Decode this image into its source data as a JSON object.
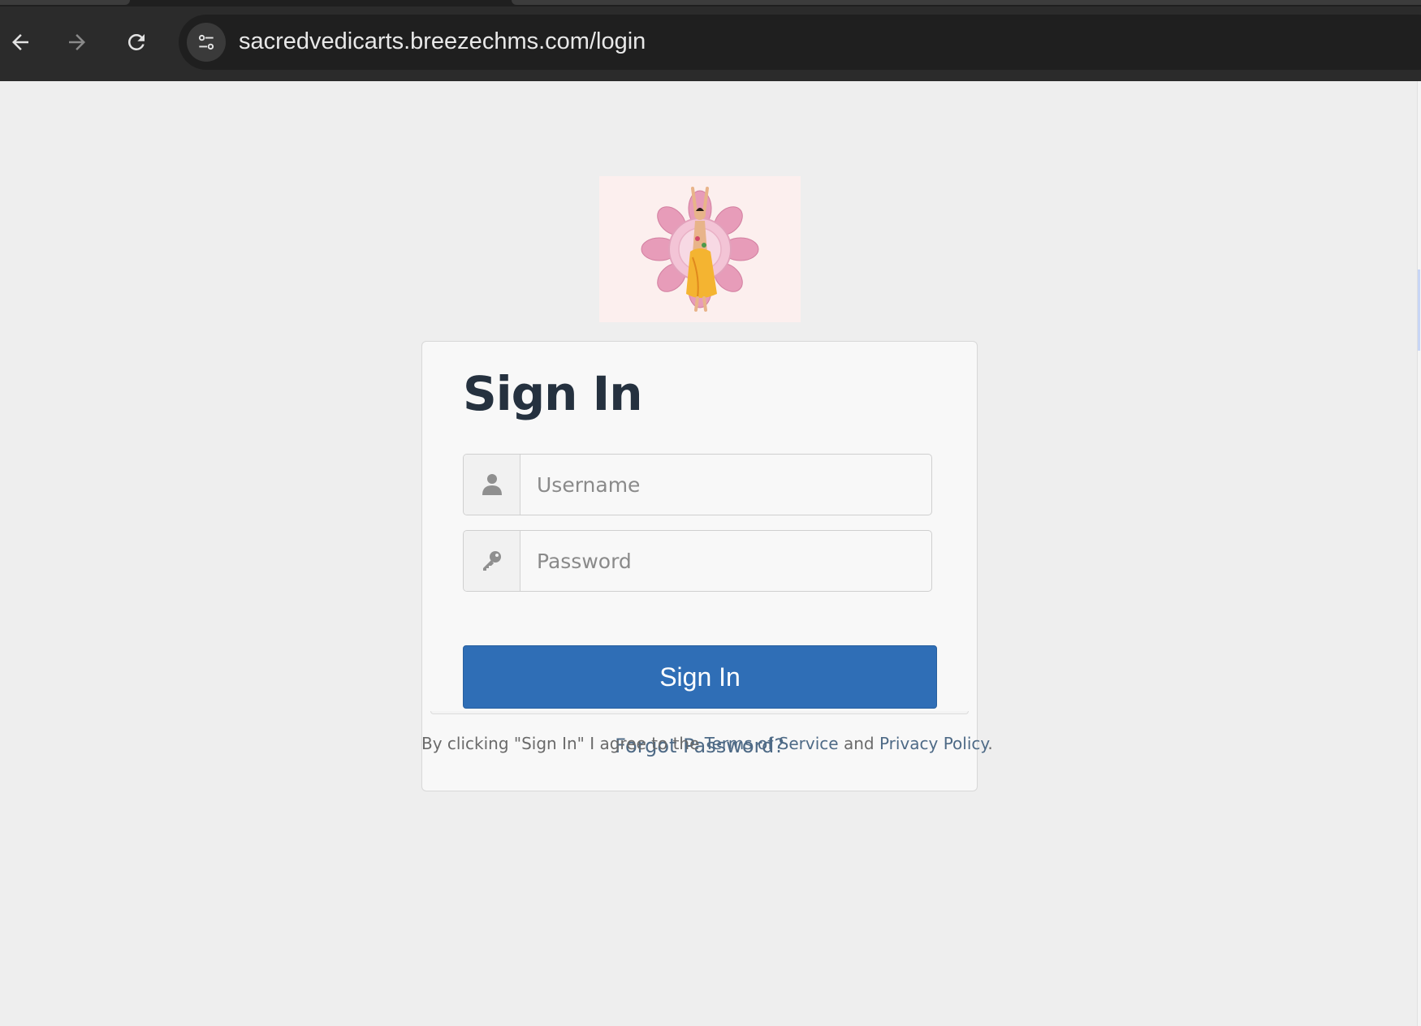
{
  "browser": {
    "url": "sacredvedicarts.breezechms.com/login",
    "icons": {
      "back": "arrow-left-icon",
      "forward": "arrow-right-icon",
      "reload": "reload-icon",
      "site_info": "tune-icon"
    }
  },
  "login": {
    "title": "Sign In",
    "username_placeholder": "Username",
    "password_placeholder": "Password",
    "username_icon": "user-icon",
    "password_icon": "key-icon",
    "submit_label": "Sign In",
    "forgot_label": "Forgot Password?"
  },
  "legal": {
    "prefix": "By clicking \"Sign In\" I agree to the ",
    "terms_label": "Terms of Service",
    "middle": " and ",
    "privacy_label": "Privacy Policy",
    "suffix": "."
  },
  "colors": {
    "primary": "#2f6eb6",
    "link": "#4e6a86",
    "title": "#25313f",
    "page_bg": "#eeeeee"
  }
}
